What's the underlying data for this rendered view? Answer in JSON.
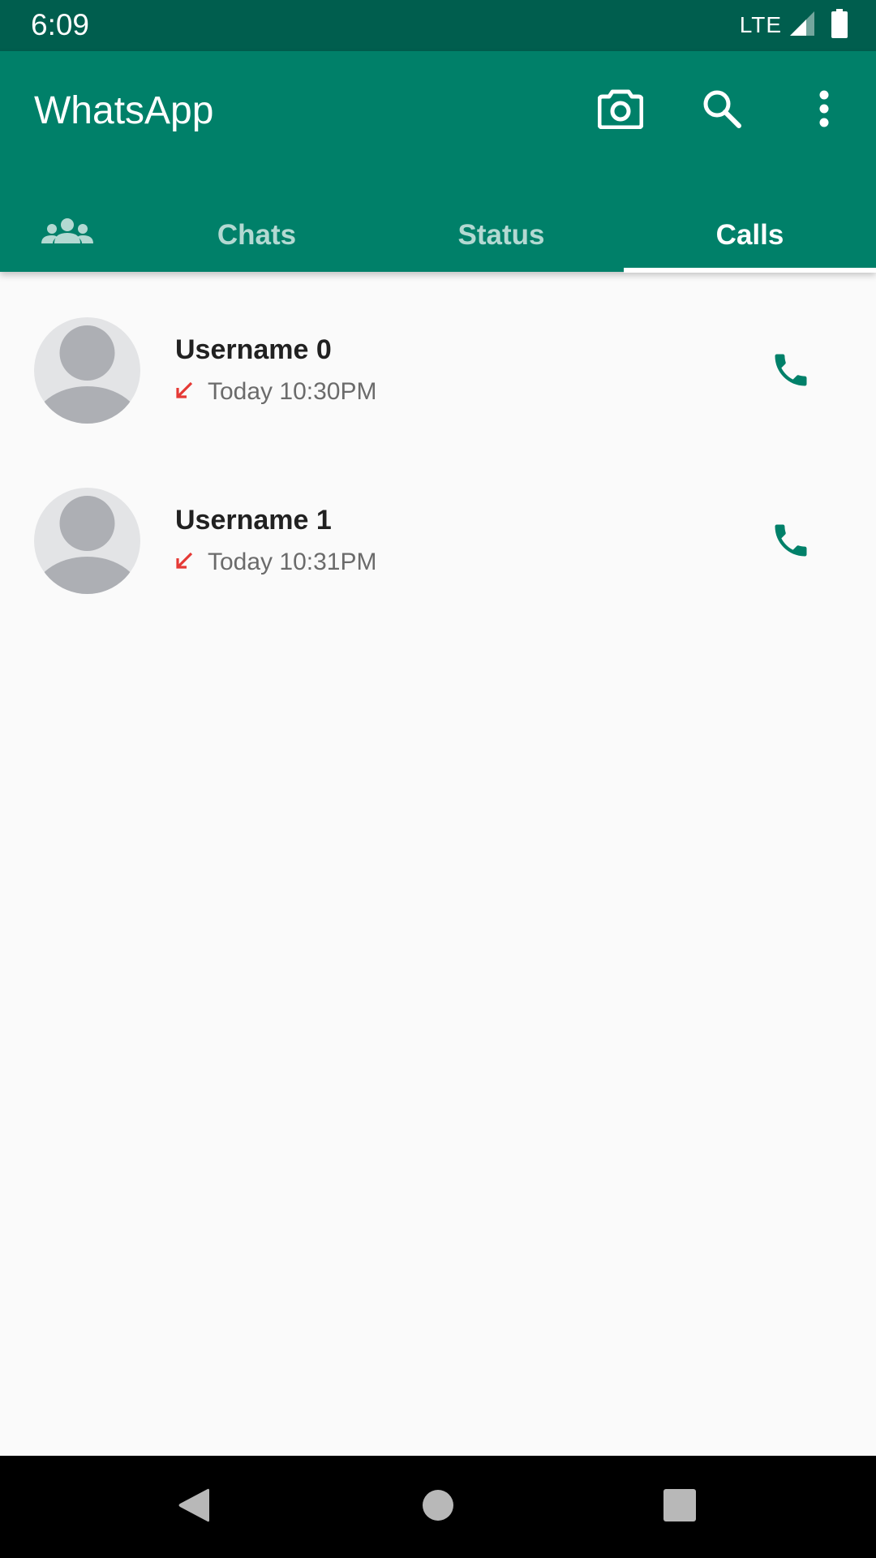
{
  "status_bar": {
    "time": "6:09",
    "network": "LTE",
    "icons": [
      "signal-icon",
      "battery-icon"
    ]
  },
  "app_bar": {
    "title": "WhatsApp",
    "actions": [
      "camera-icon",
      "search-icon",
      "more-options-icon"
    ]
  },
  "tabs": [
    {
      "icon": "communities-icon",
      "label": ""
    },
    {
      "label": "Chats"
    },
    {
      "label": "Status"
    },
    {
      "label": "Calls",
      "active": true
    }
  ],
  "calls": [
    {
      "name": "Username 0",
      "time": "Today 10:30PM",
      "direction": "missed-incoming-arrow-icon",
      "action": "phone-icon"
    },
    {
      "name": "Username 1",
      "time": "Today 10:31PM",
      "direction": "missed-incoming-arrow-icon",
      "action": "phone-icon"
    }
  ],
  "nav_bar": {
    "buttons": [
      "back-icon",
      "home-icon",
      "recents-icon"
    ]
  },
  "colors": {
    "status_bar": "#005e4e",
    "app_bar": "#008069",
    "accent": "#008069",
    "missed": "#e53935",
    "background": "#fafafa"
  }
}
